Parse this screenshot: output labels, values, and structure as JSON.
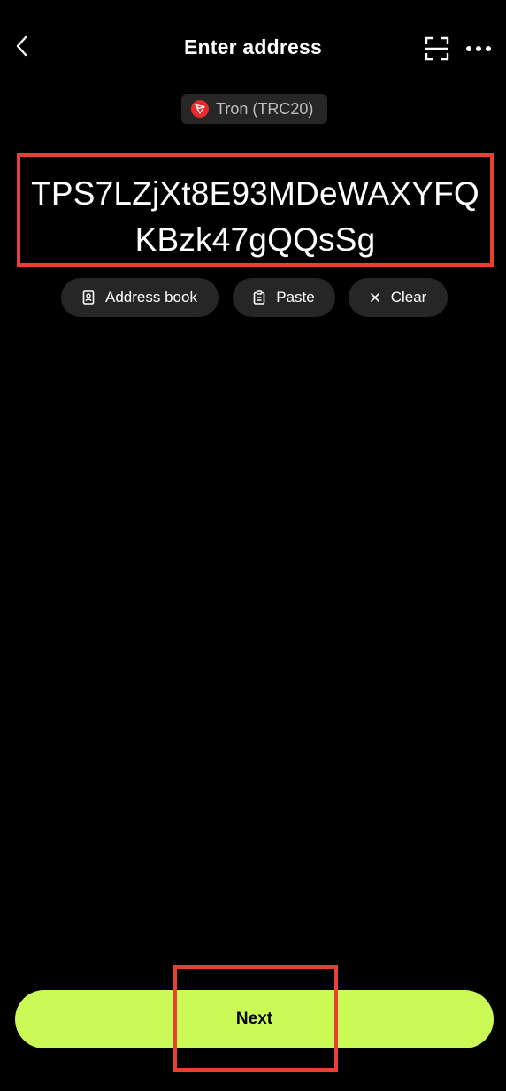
{
  "header": {
    "title": "Enter address",
    "back_icon": "chevron-left-icon",
    "scan_icon": "scan-icon",
    "more_icon": "more-horizontal-icon"
  },
  "network": {
    "label": "Tron (TRC20)",
    "icon": "tron-icon",
    "brand_color": "#e8292e"
  },
  "address": {
    "value": "TPS7LZjXt8E93MDeWAXYFQKBzk47gQQsSg",
    "highlight_color": "#e8412f"
  },
  "actions": {
    "address_book_label": "Address book",
    "paste_label": "Paste",
    "clear_label": "Clear"
  },
  "footer": {
    "next_label": "Next",
    "accent_color": "#cbf955"
  }
}
